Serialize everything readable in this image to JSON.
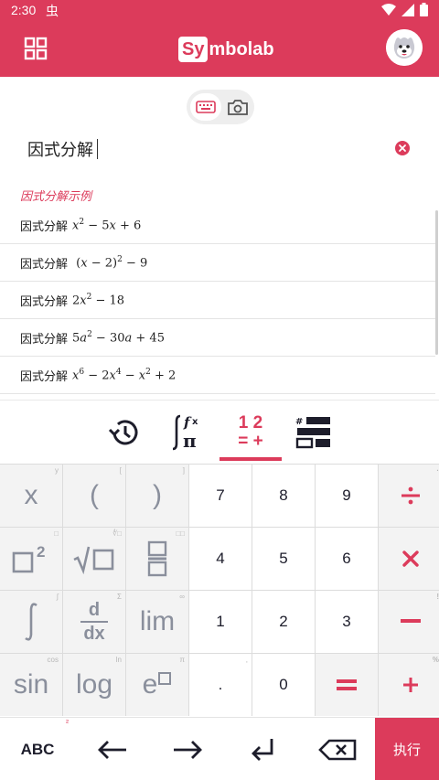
{
  "status": {
    "time": "2:30",
    "notif_glyph": "虫"
  },
  "app": {
    "logo_box": "Sy",
    "logo_rest": "mbolab"
  },
  "query": {
    "text": "因式分解"
  },
  "examples": {
    "title": "因式分解示例",
    "label": "因式分解"
  },
  "keyboard": {
    "tab_numbers_top": "1 2",
    "tab_numbers_bottom": "= +",
    "tab_icons": [
      "history-icon",
      "functions-icon",
      "numbers-icon",
      "matrix-icon"
    ],
    "keys": {
      "x": "x",
      "x_hint": "y",
      "lparen": "(",
      "lparen_hint": "[",
      "rparen": ")",
      "rparen_hint": "]",
      "seven": "7",
      "eight": "8",
      "nine": "9",
      "sq_hint": "□",
      "sqrt_hint": "∜□",
      "frac_hint": "□□",
      "four": "4",
      "five": "5",
      "six": "6",
      "ddx_d": "d",
      "ddx_dx": "dx",
      "ddx_hint": "Σ",
      "lim": "lim",
      "lim_hint": "∞",
      "one": "1",
      "two": "2",
      "three": "3",
      "sin": "sin",
      "sin_hint": "cos",
      "log": "log",
      "log_hint": "ln",
      "e": "e",
      "e_hint": "π",
      "dot": ".",
      "dot_hint": ",",
      "zero": "0",
      "div_hint": "·",
      "times_hint": "",
      "minus_hint": "!",
      "plus_hint": "%",
      "abc": "ABC",
      "abc_hint": "²",
      "execute": "执行"
    }
  },
  "colors": {
    "accent": "#dc3b5b",
    "dark": "#1d1d2b",
    "key_gray": "#8a8f9c"
  }
}
